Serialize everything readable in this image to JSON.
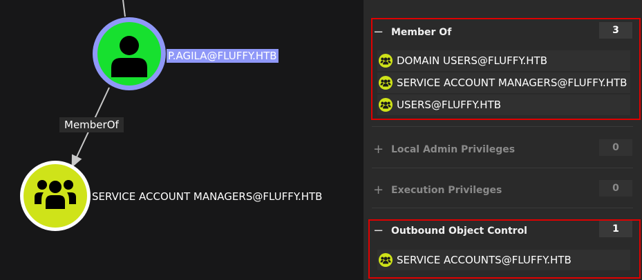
{
  "graph": {
    "user_node": {
      "label": "P.AGILA@FLUFFY.HTB",
      "color": "#17e02f",
      "ring": "#8f98f8"
    },
    "group_node": {
      "label": "SERVICE ACCOUNT MANAGERS@FLUFFY.HTB",
      "color": "#cfe319"
    },
    "edge": {
      "label": "MemberOf"
    }
  },
  "panel": {
    "member_of": {
      "title": "Member Of",
      "count": "3",
      "items": [
        {
          "label": "DOMAIN USERS@FLUFFY.HTB",
          "icon": "group-icon"
        },
        {
          "label": "SERVICE ACCOUNT MANAGERS@FLUFFY.HTB",
          "icon": "group-icon"
        },
        {
          "label": "USERS@FLUFFY.HTB",
          "icon": "group-icon"
        }
      ]
    },
    "local_admin": {
      "title": "Local Admin Privileges",
      "count": "0"
    },
    "execution": {
      "title": "Execution Privileges",
      "count": "0"
    },
    "outbound": {
      "title": "Outbound Object Control",
      "count": "1",
      "items": [
        {
          "label": "SERVICE ACCOUNTS@FLUFFY.HTB",
          "icon": "group-icon"
        }
      ]
    },
    "toggle_expanded": "−",
    "toggle_collapsed": "+"
  },
  "colors": {
    "highlight": "#e00000",
    "group_icon": "#cfe319",
    "edge": "#c8c8c8"
  }
}
